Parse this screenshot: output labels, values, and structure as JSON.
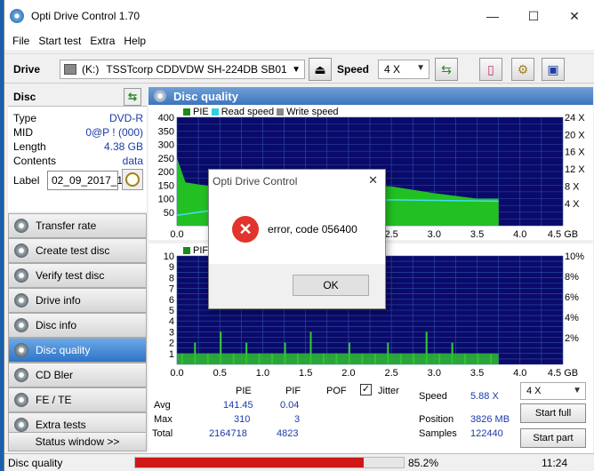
{
  "window": {
    "title": "Opti Drive Control 1.70"
  },
  "menu": [
    "File",
    "Start test",
    "Extra",
    "Help"
  ],
  "toolbar": {
    "drive_label": "Drive",
    "drive_letter": "(K:)",
    "drive_name": "TSSTcorp CDDVDW SH-224DB SB01",
    "speed_label": "Speed",
    "speed_value": "4 X"
  },
  "disc": {
    "header": "Disc",
    "rows": [
      {
        "k": "Type",
        "v": "DVD-R"
      },
      {
        "k": "MID",
        "v": "0@P ! (000)"
      },
      {
        "k": "Length",
        "v": "4.38 GB"
      },
      {
        "k": "Contents",
        "v": "data"
      }
    ],
    "label_key": "Label",
    "label_value": "02_09_2017_1"
  },
  "nav": [
    "Transfer rate",
    "Create test disc",
    "Verify test disc",
    "Drive info",
    "Disc info",
    "Disc quality",
    "CD Bler",
    "FE / TE",
    "Extra tests"
  ],
  "status_window_btn": "Status window >>",
  "main": {
    "title": "Disc quality"
  },
  "chart_data": [
    {
      "type": "area",
      "legend": [
        "PIE",
        "Read speed",
        "Write speed"
      ],
      "y_ticks": [
        "400",
        "350",
        "300",
        "250",
        "200",
        "150",
        "100",
        "50"
      ],
      "y2_ticks": [
        "24 X",
        "20 X",
        "16 X",
        "12 X",
        "8 X",
        "4 X"
      ],
      "x_ticks": [
        "0.0",
        "0.5",
        "1.0",
        "1.5",
        "2.0",
        "2.5",
        "3.0",
        "3.5",
        "4.0",
        "4.5 GB"
      ],
      "x": [
        0.0,
        0.1,
        0.5,
        1.0,
        1.5,
        2.0,
        2.5,
        3.0,
        3.5,
        3.75
      ],
      "pie": [
        250,
        160,
        140,
        135,
        140,
        150,
        145,
        120,
        100,
        100
      ],
      "read_speed_x": [
        2.5,
        5.4,
        6.2,
        5.9
      ],
      "ylim": [
        0,
        400
      ],
      "xlim": [
        0,
        4.5
      ]
    },
    {
      "type": "bar",
      "legend": [
        "PIF",
        "Jitter"
      ],
      "y_ticks": [
        "10",
        "9",
        "8",
        "7",
        "6",
        "5",
        "4",
        "3",
        "2",
        "1"
      ],
      "y2_ticks": [
        "10%",
        "8%",
        "6%",
        "4%",
        "2%"
      ],
      "x_ticks": [
        "0.0",
        "0.5",
        "1.0",
        "1.5",
        "2.0",
        "2.5",
        "3.0",
        "3.5",
        "4.0",
        "4.5 GB"
      ],
      "ylim": [
        0,
        10
      ],
      "xlim": [
        0,
        4.5
      ]
    }
  ],
  "stats": {
    "col_pie": "PIE",
    "col_pif": "PIF",
    "col_pof": "POF",
    "jitter": "Jitter",
    "avg_label": "Avg",
    "avg_pie": "141.45",
    "avg_pif": "0.04",
    "max_label": "Max",
    "max_pie": "310",
    "max_pif": "3",
    "total_label": "Total",
    "total_pie": "2164718",
    "total_pif": "4823",
    "speed_label": "Speed",
    "speed_value": "5.88 X",
    "speed_select": "4 X",
    "position_label": "Position",
    "position_value": "3826 MB",
    "samples_label": "Samples",
    "samples_value": "122440",
    "start_full": "Start full",
    "start_part": "Start part"
  },
  "status": {
    "text": "Disc quality",
    "progress": 85.2,
    "percent": "85.2%",
    "time": "11:24"
  },
  "dialog": {
    "title": "Opti Drive Control",
    "message": "error, code 056400",
    "ok": "OK"
  }
}
